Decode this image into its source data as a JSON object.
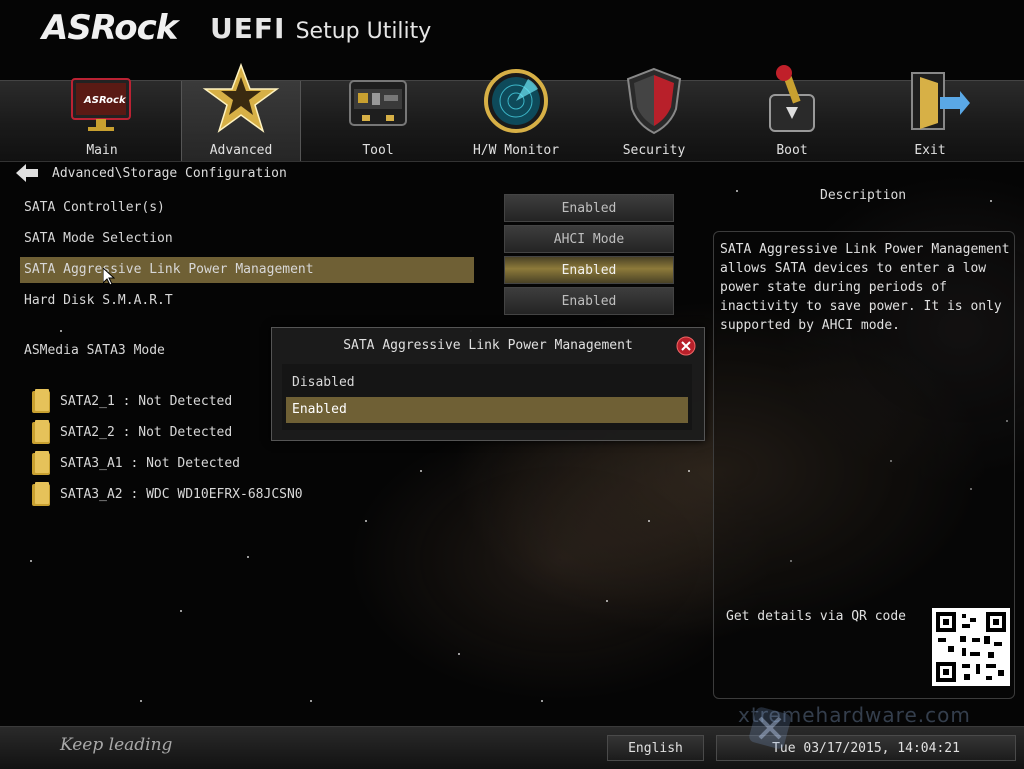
{
  "header": {
    "brand": "ASRock",
    "uefi": "UEFI",
    "setup": "Setup Utility"
  },
  "nav": {
    "tabs": [
      {
        "label": "Main",
        "icon": "monitor-icon"
      },
      {
        "label": "Advanced",
        "icon": "star-icon",
        "active": true
      },
      {
        "label": "Tool",
        "icon": "toolbox-icon"
      },
      {
        "label": "H/W Monitor",
        "icon": "radar-icon"
      },
      {
        "label": "Security",
        "icon": "shield-icon"
      },
      {
        "label": "Boot",
        "icon": "joystick-icon"
      },
      {
        "label": "Exit",
        "icon": "exit-door-icon"
      }
    ]
  },
  "breadcrumb": "Advanced\\Storage Configuration",
  "settings": [
    {
      "label": "SATA Controller(s)",
      "value": "Enabled"
    },
    {
      "label": "SATA Mode Selection",
      "value": "AHCI Mode"
    },
    {
      "label": "SATA Aggressive Link Power Management",
      "value": "Enabled",
      "selected": true
    },
    {
      "label": "Hard Disk S.M.A.R.T",
      "value": "Enabled"
    },
    {
      "label": "ASMedia SATA3 Mode"
    }
  ],
  "drives": [
    "SATA2_1 : Not Detected",
    "SATA2_2 : Not Detected",
    "SATA3_A1 : Not Detected",
    "SATA3_A2 : WDC WD10EFRX-68JCSN0"
  ],
  "popup": {
    "title": "SATA Aggressive Link Power Management",
    "options": [
      "Disabled",
      "Enabled"
    ],
    "selected": "Enabled"
  },
  "description": {
    "title": "Description",
    "text": "SATA Aggressive Link Power Management allows SATA devices to enter a low power state during periods of inactivity to save power. It is only supported by AHCI mode.",
    "qr_label": "Get details via QR code"
  },
  "footer": {
    "slogan": "Keep leading",
    "language": "English",
    "datetime": "Tue 03/17/2015, 14:04:21",
    "watermark": "xtremehardware.com"
  },
  "colors": {
    "highlight": "#6f6035",
    "accent_gold": "#d7b046"
  }
}
